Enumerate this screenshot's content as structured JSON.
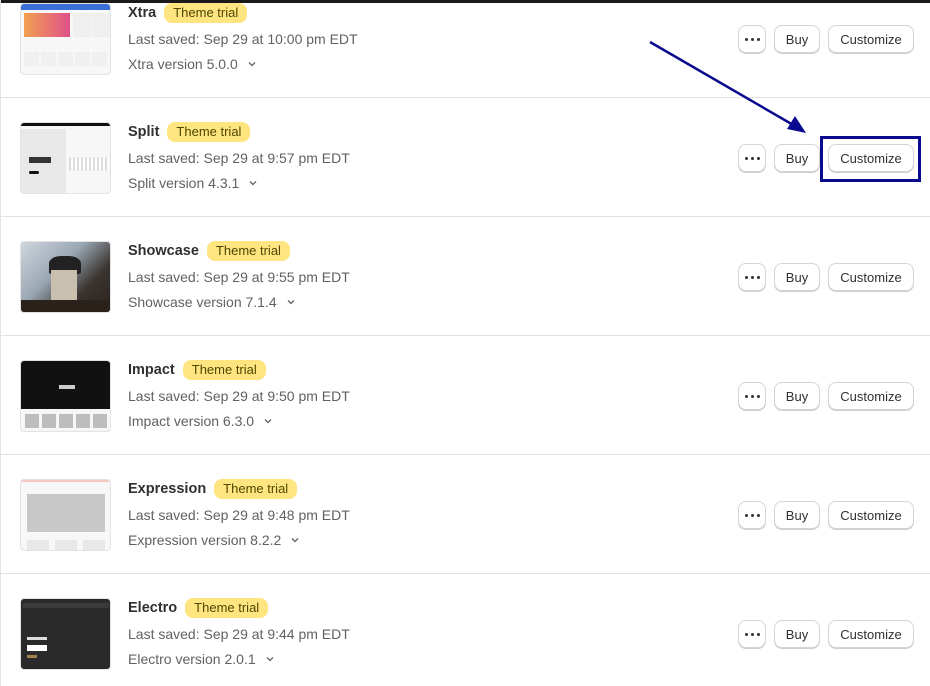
{
  "themes": [
    {
      "name": "Xtra",
      "badge": "Theme trial",
      "last_saved": "Last saved: Sep 29 at 10:00 pm EDT",
      "version": "Xtra version 5.0.0",
      "thumbnail": "xtra-preview"
    },
    {
      "name": "Split",
      "badge": "Theme trial",
      "last_saved": "Last saved: Sep 29 at 9:57 pm EDT",
      "version": "Split version 4.3.1",
      "thumbnail": "split-preview"
    },
    {
      "name": "Showcase",
      "badge": "Theme trial",
      "last_saved": "Last saved: Sep 29 at 9:55 pm EDT",
      "version": "Showcase version 7.1.4",
      "thumbnail": "showcase-preview"
    },
    {
      "name": "Impact",
      "badge": "Theme trial",
      "last_saved": "Last saved: Sep 29 at 9:50 pm EDT",
      "version": "Impact version 6.3.0",
      "thumbnail": "impact-preview"
    },
    {
      "name": "Expression",
      "badge": "Theme trial",
      "last_saved": "Last saved: Sep 29 at 9:48 pm EDT",
      "version": "Expression version 8.2.2",
      "thumbnail": "expression-preview"
    },
    {
      "name": "Electro",
      "badge": "Theme trial",
      "last_saved": "Last saved: Sep 29 at 9:44 pm EDT",
      "version": "Electro version 2.0.1",
      "thumbnail": "electro-preview"
    }
  ],
  "actions": {
    "more_icon": "ellipsis-icon",
    "buy_label": "Buy",
    "customize_label": "Customize"
  },
  "annotation": {
    "highlighted_button": "Split Customize",
    "color": "#0a0a8f"
  },
  "colors": {
    "badge_bg": "#ffe57f",
    "badge_text": "#4f4700",
    "text_primary": "#303030",
    "text_secondary": "#616161"
  }
}
